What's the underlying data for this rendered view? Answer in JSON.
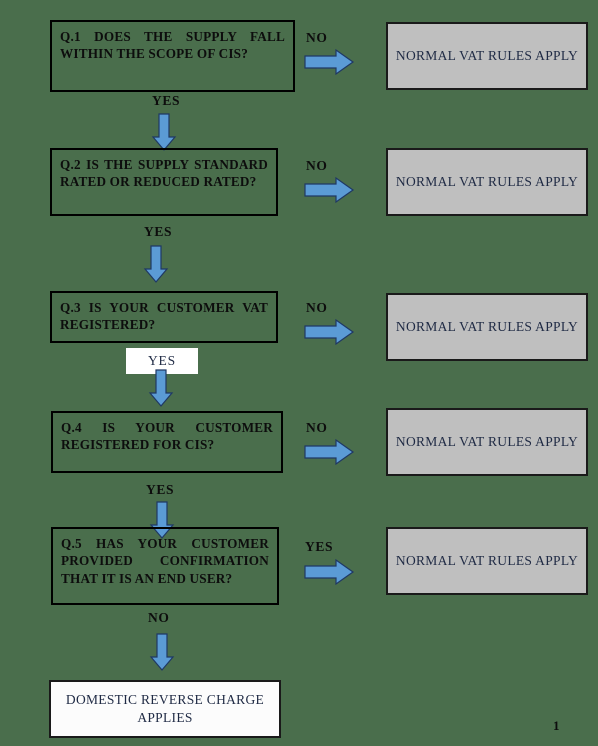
{
  "document": {
    "title": "CIS VAT Domestic Reverse Charge Decision Flowchart",
    "page_number": "1",
    "background_color": "#4A6E4C",
    "arrow_color": "#5B9BD5",
    "arrow_outline_color": "#1F3864",
    "outcome_box_fill": "#BFBFBF",
    "final_box_fill": "#FCFCFC",
    "box_border_color": "#000000",
    "outcome_text_color": "#1F2A44"
  },
  "questions": [
    {
      "id": "q1",
      "text": "Q.1 DOES THE SUPPLY FALL WITHIN THE SCOPE OF CIS?",
      "no_label": "NO",
      "yes_label": "YES"
    },
    {
      "id": "q2",
      "text": "Q.2 IS THE SUPPLY STANDARD RATED OR REDUCED RATED?",
      "no_label": "NO",
      "yes_label": "YES"
    },
    {
      "id": "q3",
      "text": "Q.3 IS YOUR CUSTOMER VAT REGISTERED?",
      "no_label": "NO",
      "yes_label": "YES"
    },
    {
      "id": "q4",
      "text": "Q.4 IS YOUR CUSTOMER REGISTERED FOR CIS?",
      "no_label": "NO",
      "yes_label": "YES"
    },
    {
      "id": "q5",
      "text": "Q.5 HAS YOUR CUSTOMER PROVIDED CONFIRMATION THAT IT IS AN END USER?",
      "yes_label": "YES",
      "no_label": "NO"
    }
  ],
  "outcomes": [
    {
      "id": "o1",
      "text": "NORMAL VAT RULES APPLY"
    },
    {
      "id": "o2",
      "text": "NORMAL VAT RULES APPLY"
    },
    {
      "id": "o3",
      "text": "NORMAL VAT RULES APPLY"
    },
    {
      "id": "o4",
      "text": "NORMAL VAT RULES APPLY"
    },
    {
      "id": "o5",
      "text": "NORMAL VAT RULES APPLY"
    }
  ],
  "final_outcome": {
    "id": "final",
    "text": "DOMESTIC REVERSE CHARGE APPLIES"
  },
  "icons": {
    "right_arrow": "arrow-right-icon",
    "down_arrow": "arrow-down-icon"
  }
}
